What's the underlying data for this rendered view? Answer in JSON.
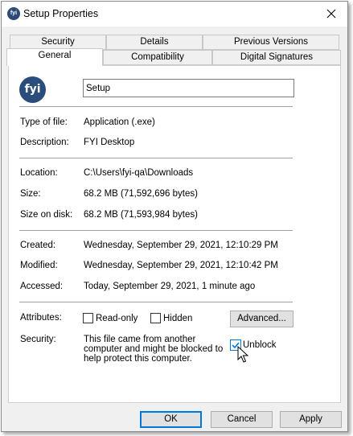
{
  "window": {
    "title": "Setup Properties",
    "icon": "fyi-app-icon",
    "close_icon": "close-icon"
  },
  "tabs": {
    "row1": [
      "Security",
      "Details",
      "Previous Versions"
    ],
    "row2": [
      "General",
      "Compatibility",
      "Digital Signatures"
    ],
    "active": "General"
  },
  "general": {
    "logo_text": "fyi",
    "name_value": "Setup",
    "type_label": "Type of file:",
    "type_value": "Application (.exe)",
    "description_label": "Description:",
    "description_value": "FYI Desktop",
    "location_label": "Location:",
    "location_value": "C:\\Users\\fyi-qa\\Downloads",
    "size_label": "Size:",
    "size_value": "68.2 MB (71,592,696 bytes)",
    "size_on_disk_label": "Size on disk:",
    "size_on_disk_value": "68.2 MB (71,593,984 bytes)",
    "created_label": "Created:",
    "created_value": "Wednesday, September 29, 2021, 12:10:29 PM",
    "modified_label": "Modified:",
    "modified_value": "Wednesday, September 29, 2021, 12:10:42 PM",
    "accessed_label": "Accessed:",
    "accessed_value": "Today, September 29, 2021, 1 minute ago",
    "attributes_label": "Attributes:",
    "readonly_label": "Read-only",
    "hidden_label": "Hidden",
    "advanced_label": "Advanced...",
    "security_label": "Security:",
    "security_text": "This file came from another computer and might be blocked to help protect this computer.",
    "unblock_label": "Unblock",
    "unblock_checked": true
  },
  "buttons": {
    "ok": "OK",
    "cancel": "Cancel",
    "apply": "Apply"
  },
  "colors": {
    "accent": "#0078d7",
    "logo": "#2a4d7c"
  }
}
